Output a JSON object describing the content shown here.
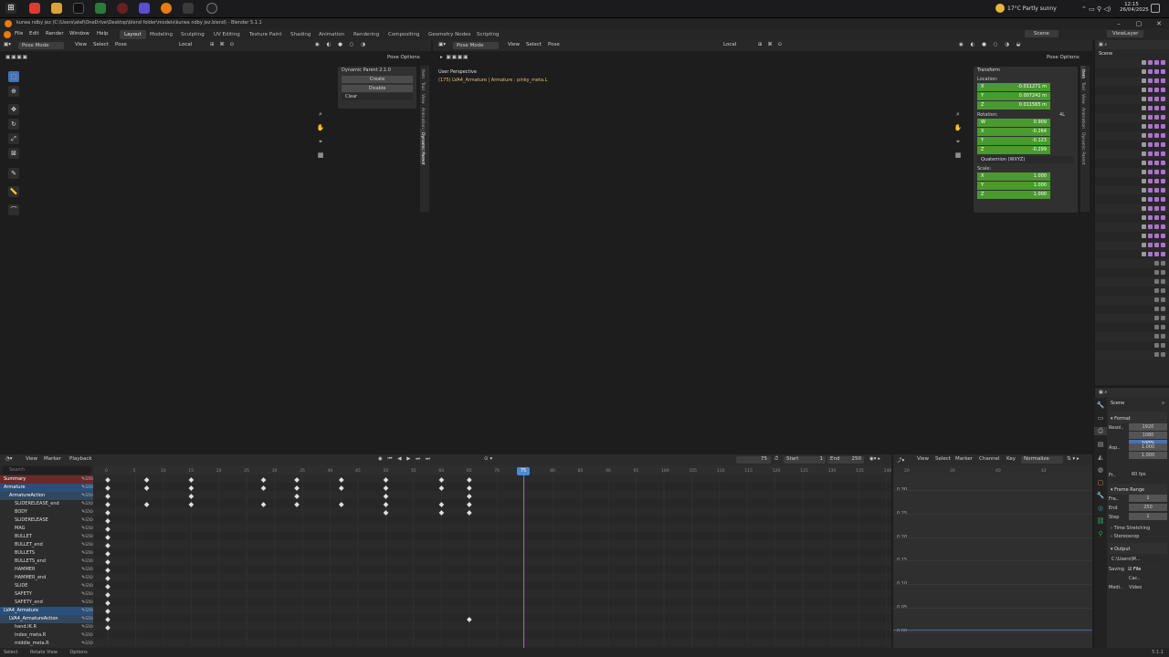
{
  "taskbar": {
    "weather": "17°C Partly sunny",
    "time": "12:15",
    "date": "26/04/2025"
  },
  "window": {
    "title": "kurwa ndby jez (C:\\Users\\atef\\OneDrive\\Desktop\\blend folder\\models\\kurwa ndby jez.blend) - Blender 5.1.1"
  },
  "menu": {
    "items": [
      "File",
      "Edit",
      "Render",
      "Window",
      "Help"
    ],
    "workspaces": [
      "Layout",
      "Modeling",
      "Sculpting",
      "UV Editing",
      "Texture Paint",
      "Shading",
      "Animation",
      "Rendering",
      "Compositing",
      "Geometry Nodes",
      "Scripting"
    ],
    "active_workspace": "Layout",
    "scene": "Scene",
    "view_layer": "ViewLayer"
  },
  "left_viewport": {
    "mode": "Pose Mode",
    "menus": [
      "View",
      "Select",
      "Pose"
    ],
    "orientation": "Local",
    "pose_options": "Pose Options",
    "addon_panel": {
      "title": "Dynamic Parent 2.1.0",
      "create": "Create",
      "disable": "Disable",
      "clear": "Clear"
    },
    "tabs": [
      "Item",
      "Tool",
      "View",
      "Animation",
      "Dynamic Parent"
    ]
  },
  "right_viewport": {
    "mode": "Pose Mode",
    "menus": [
      "View",
      "Select",
      "Pose"
    ],
    "orientation": "Local",
    "pose_options": "Pose Options",
    "perspective": "User Perspective",
    "selection": "(175) LVA4_Armature | Armature : pinky_meta.L",
    "tabs": [
      "Item",
      "Tool",
      "View",
      "Animation",
      "Dynamic Parent"
    ],
    "transform": {
      "title": "Transform",
      "location_label": "Location:",
      "location": [
        {
          "axis": "X",
          "value": "-0.011271 m"
        },
        {
          "axis": "Y",
          "value": "0.007242 m"
        },
        {
          "axis": "Z",
          "value": "0.011565 m"
        }
      ],
      "rotation_label": "Rotation:",
      "rotation_num": "4L",
      "rotation": [
        {
          "axis": "W",
          "value": "0.909"
        },
        {
          "axis": "X",
          "value": "-0.264"
        },
        {
          "axis": "Y",
          "value": "-0.123"
        },
        {
          "axis": "Z",
          "value": "-0.299"
        }
      ],
      "rotation_mode": "Quaternion (WXYZ)",
      "scale_label": "Scale:",
      "scale": [
        {
          "axis": "X",
          "value": "1.000"
        },
        {
          "axis": "Y",
          "value": "1.000"
        },
        {
          "axis": "Z",
          "value": "1.000"
        }
      ]
    }
  },
  "dopesheet": {
    "menus": [
      "View",
      "Marker",
      "Playback"
    ],
    "search_placeholder": "Search",
    "start_label": "Start",
    "start_value": "1",
    "end_label": "End",
    "end_value": "250",
    "current_frame": "75",
    "playhead": "75",
    "ticks": [
      "0",
      "5",
      "10",
      "15",
      "20",
      "25",
      "30",
      "35",
      "40",
      "45",
      "50",
      "55",
      "60",
      "65",
      "70",
      "75",
      "80",
      "85",
      "90",
      "95",
      "100",
      "105",
      "110",
      "115",
      "120",
      "125",
      "130",
      "135",
      "140"
    ],
    "channels": [
      {
        "name": "Summary",
        "level": 0,
        "color": "#6b2a2a",
        "text": "#ffffff"
      },
      {
        "name": "Armature",
        "level": 0,
        "color": "#2a4f7a",
        "text": "#ffffff"
      },
      {
        "name": "ArmatureAction",
        "level": 1,
        "color": "#31475f",
        "text": "#ffffff"
      },
      {
        "name": "SLIDERELEASE_end",
        "level": 2,
        "color": "#2c2c2c",
        "text": "#dddddd"
      },
      {
        "name": "BODY",
        "level": 2,
        "color": "#2c2c2c",
        "text": "#dddddd"
      },
      {
        "name": "SLIDERELEASE",
        "level": 2,
        "color": "#2c2c2c",
        "text": "#dddddd"
      },
      {
        "name": "MAG",
        "level": 2,
        "color": "#2c2c2c",
        "text": "#dddddd"
      },
      {
        "name": "BULLET",
        "level": 2,
        "color": "#2c2c2c",
        "text": "#dddddd"
      },
      {
        "name": "BULLET_end",
        "level": 2,
        "color": "#2c2c2c",
        "text": "#dddddd"
      },
      {
        "name": "BULLETS",
        "level": 2,
        "color": "#2c2c2c",
        "text": "#dddddd"
      },
      {
        "name": "BULLETS_end",
        "level": 2,
        "color": "#2c2c2c",
        "text": "#dddddd"
      },
      {
        "name": "HAMMER",
        "level": 2,
        "color": "#2c2c2c",
        "text": "#dddddd"
      },
      {
        "name": "HAMMER_end",
        "level": 2,
        "color": "#2c2c2c",
        "text": "#dddddd"
      },
      {
        "name": "SLIDE",
        "level": 2,
        "color": "#2c2c2c",
        "text": "#dddddd"
      },
      {
        "name": "SAFETY",
        "level": 2,
        "color": "#2c2c2c",
        "text": "#dddddd"
      },
      {
        "name": "SAFETY_end",
        "level": 2,
        "color": "#2c2c2c",
        "text": "#dddddd"
      },
      {
        "name": "LVA4_Armature",
        "level": 0,
        "color": "#2a4f7a",
        "text": "#ffffff"
      },
      {
        "name": "LVA4_ArmatureAction",
        "level": 1,
        "color": "#31475f",
        "text": "#ffffff"
      },
      {
        "name": "hand.IK.R",
        "level": 2,
        "color": "#2c2c2c",
        "text": "#dddddd"
      },
      {
        "name": "index_meta.R",
        "level": 2,
        "color": "#2c2c2c",
        "text": "#dddddd"
      },
      {
        "name": "middle_meta.R",
        "level": 2,
        "color": "#2c2c2c",
        "text": "#dddddd"
      }
    ]
  },
  "graph_editor": {
    "menus": [
      "View",
      "Select",
      "Marker",
      "Channel",
      "Key"
    ],
    "normalize": "Normalize",
    "ticks": [
      "20",
      "30",
      "40",
      "42"
    ],
    "y_labels": [
      "0.30",
      "0.25",
      "0.20",
      "0.15",
      "0.10",
      "0.05",
      "0.00"
    ]
  },
  "properties": {
    "scene": "Scene",
    "format_title": "Format",
    "resolution_label": "Resol..",
    "res_x": "1920",
    "res_y": "1080",
    "res_pct": "100%",
    "aspect_label": "Asp..",
    "aspect_x": "1.000",
    "aspect_y": "1.000",
    "frame_rate_label": "Fr..",
    "frame_rate": "60 fps",
    "frame_range_title": "Frame Range",
    "frame_start_label": "Fra..",
    "frame_start": "1",
    "end_label": "End",
    "frame_end": "250",
    "step_label": "Step",
    "frame_step": "1",
    "time_stretching": "Time Stretching",
    "stereoscopy": "Stereoscop",
    "output_title": "Output",
    "output_path": "C:\\Users\\M...",
    "saving_label": "Saving",
    "file_label": "File",
    "cac_label": "Cac..",
    "media_label": "Medi..",
    "video": "Video"
  },
  "statusbar": {
    "select": "Select",
    "rotate": "Rotate View",
    "options": "Options",
    "version": "5.1.1"
  },
  "colors": {
    "accent": "#4772b3",
    "field_green": "#4a9a2f",
    "playhead": "#4a8ad8"
  }
}
